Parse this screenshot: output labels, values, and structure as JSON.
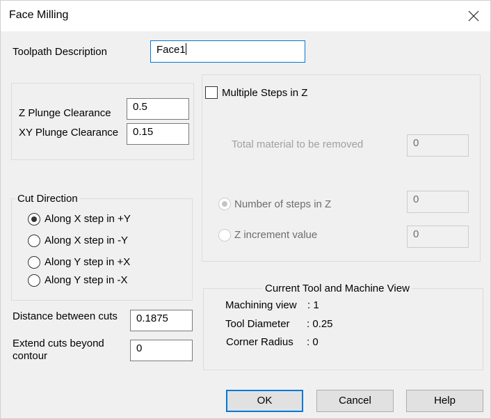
{
  "window": {
    "title": "Face Milling",
    "close_icon": "close-x-icon"
  },
  "toolpath": {
    "label": "Toolpath Description",
    "value": "Face1"
  },
  "plunge": {
    "z_label": "Z Plunge Clearance",
    "z_value": "0.5",
    "xy_label": "XY Plunge Clearance",
    "xy_value": "0.15"
  },
  "cut_direction": {
    "title": "Cut Direction",
    "options": [
      {
        "label": "Along X step in +Y",
        "checked": true
      },
      {
        "label": "Along X step in -Y",
        "checked": false
      },
      {
        "label": "Along Y step in +X",
        "checked": false
      },
      {
        "label": "Along Y step in -X",
        "checked": false
      }
    ]
  },
  "distance": {
    "label": "Distance between cuts",
    "value": "0.1875"
  },
  "extend": {
    "label_line1": "Extend cuts beyond",
    "label_line2": "contour",
    "value": "0"
  },
  "multi_steps": {
    "checkbox_label": "Multiple Steps in Z",
    "checked": false,
    "total_label": "Total material to be removed",
    "total_value": "0",
    "num_steps_label": "Number of steps in Z",
    "num_steps_value": "0",
    "num_steps_checked": true,
    "z_inc_label": "Z increment value",
    "z_inc_value": "0",
    "z_inc_checked": false
  },
  "tool_view": {
    "title": "Current Tool and Machine View",
    "machining_view_label": "Machining view",
    "machining_view_value": ": 1",
    "tool_diameter_label": "Tool Diameter",
    "tool_diameter_value": ": 0.25",
    "corner_radius_label": "Corner Radius",
    "corner_radius_value": ": 0"
  },
  "buttons": {
    "ok": "OK",
    "cancel": "Cancel",
    "help": "Help"
  },
  "colors": {
    "accent": "#0078d7",
    "background": "#f0f0f0",
    "disabled_text": "#6d6d6d"
  }
}
